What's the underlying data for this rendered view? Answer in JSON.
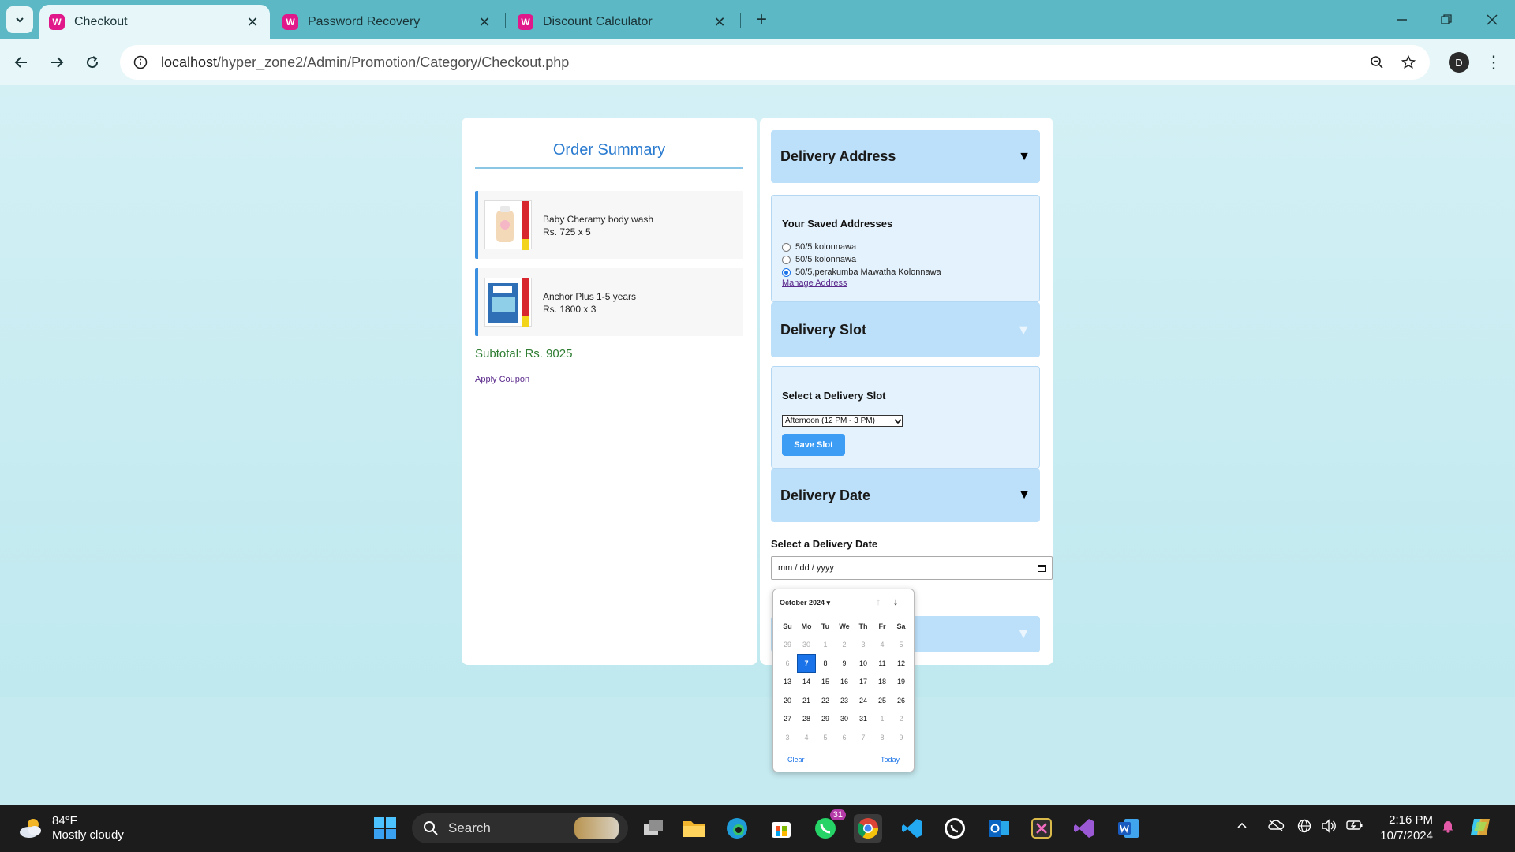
{
  "browser": {
    "tabs": [
      {
        "title": "Checkout",
        "active": true
      },
      {
        "title": "Password Recovery",
        "active": false
      },
      {
        "title": "Discount Calculator",
        "active": false
      }
    ],
    "url_host": "localhost",
    "url_path": "/hyper_zone2/Admin/Promotion/Category/Checkout.php",
    "profile_initial": "D"
  },
  "order_summary": {
    "title": "Order Summary",
    "items": [
      {
        "name": "Baby Cheramy body wash",
        "price_line": "Rs. 725 x 5"
      },
      {
        "name": "Anchor Plus 1-5 years",
        "price_line": "Rs. 1800 x 3"
      }
    ],
    "subtotal": "Subtotal: Rs. 9025",
    "apply_coupon": "Apply Coupon"
  },
  "delivery_address": {
    "heading": "Delivery Address",
    "arrow": "▼",
    "saved_heading": "Your Saved Addresses",
    "addresses": [
      {
        "label": "50/5 kolonnawa",
        "checked": false
      },
      {
        "label": "50/5 kolonnawa",
        "checked": false
      },
      {
        "label": "50/5,perakumba Mawatha Kolonnawa",
        "checked": true
      }
    ],
    "manage_link": "Manage Address"
  },
  "delivery_slot": {
    "heading": "Delivery Slot",
    "arrow": "▼",
    "select_heading": "Select a Delivery Slot",
    "selected_option": "Afternoon (12 PM - 3 PM)",
    "save_button": "Save Slot"
  },
  "delivery_date": {
    "heading": "Delivery Date",
    "arrow": "▼",
    "select_label": "Select a Delivery Date",
    "input_placeholder": "mm / dd / yyyy",
    "hidden_arrow": "▼"
  },
  "datepicker": {
    "month_label": "October 2024 ▾",
    "weekdays": [
      "Su",
      "Mo",
      "Tu",
      "We",
      "Th",
      "Fr",
      "Sa"
    ],
    "days": [
      {
        "d": "29",
        "s": "out"
      },
      {
        "d": "30",
        "s": "out"
      },
      {
        "d": "1",
        "s": "out"
      },
      {
        "d": "2",
        "s": "out"
      },
      {
        "d": "3",
        "s": "out"
      },
      {
        "d": "4",
        "s": "out"
      },
      {
        "d": "5",
        "s": "out"
      },
      {
        "d": "6",
        "s": "out"
      },
      {
        "d": "7",
        "s": "selected"
      },
      {
        "d": "8",
        "s": ""
      },
      {
        "d": "9",
        "s": ""
      },
      {
        "d": "10",
        "s": ""
      },
      {
        "d": "11",
        "s": ""
      },
      {
        "d": "12",
        "s": ""
      },
      {
        "d": "13",
        "s": ""
      },
      {
        "d": "14",
        "s": ""
      },
      {
        "d": "15",
        "s": ""
      },
      {
        "d": "16",
        "s": ""
      },
      {
        "d": "17",
        "s": ""
      },
      {
        "d": "18",
        "s": ""
      },
      {
        "d": "19",
        "s": ""
      },
      {
        "d": "20",
        "s": ""
      },
      {
        "d": "21",
        "s": ""
      },
      {
        "d": "22",
        "s": ""
      },
      {
        "d": "23",
        "s": ""
      },
      {
        "d": "24",
        "s": ""
      },
      {
        "d": "25",
        "s": ""
      },
      {
        "d": "26",
        "s": ""
      },
      {
        "d": "27",
        "s": ""
      },
      {
        "d": "28",
        "s": ""
      },
      {
        "d": "29",
        "s": ""
      },
      {
        "d": "30",
        "s": ""
      },
      {
        "d": "31",
        "s": ""
      },
      {
        "d": "1",
        "s": "out"
      },
      {
        "d": "2",
        "s": "out"
      },
      {
        "d": "3",
        "s": "out"
      },
      {
        "d": "4",
        "s": "out"
      },
      {
        "d": "5",
        "s": "out"
      },
      {
        "d": "6",
        "s": "out"
      },
      {
        "d": "7",
        "s": "out"
      },
      {
        "d": "8",
        "s": "out"
      },
      {
        "d": "9",
        "s": "out"
      }
    ],
    "clear": "Clear",
    "today": "Today"
  },
  "taskbar": {
    "temperature": "84°F",
    "weather": "Mostly cloudy",
    "search_label": "Search",
    "whatsapp_badge": "31",
    "time": "2:16 PM",
    "date": "10/7/2024"
  }
}
